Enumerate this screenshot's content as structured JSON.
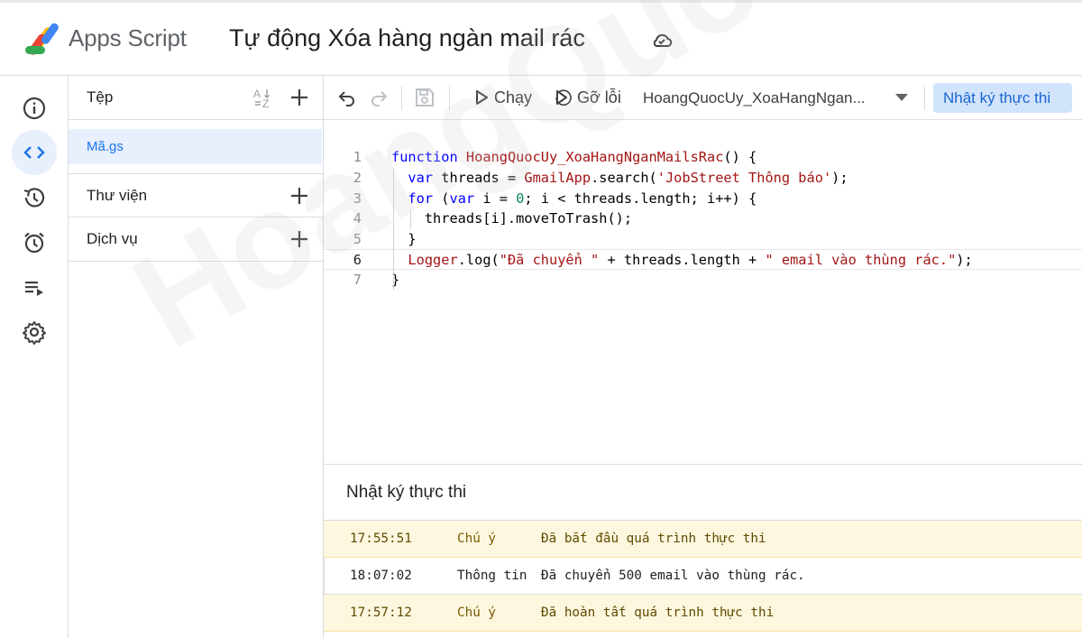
{
  "header": {
    "app_name": "Apps Script",
    "project_title": "Tự động Xóa hàng ngàn mail rác",
    "cloud_status_icon": "cloud-saved-icon"
  },
  "rail": {
    "items": [
      {
        "name": "overview",
        "icon": "info-icon"
      },
      {
        "name": "editor",
        "icon": "code-icon",
        "active": true
      },
      {
        "name": "history",
        "icon": "history-icon"
      },
      {
        "name": "triggers",
        "icon": "alarm-icon"
      },
      {
        "name": "executions",
        "icon": "playlist-play-icon"
      },
      {
        "name": "settings",
        "icon": "gear-icon"
      }
    ]
  },
  "files": {
    "header_label": "Tệp",
    "file_name": "Mã.gs",
    "libraries_label": "Thư viện",
    "services_label": "Dịch vụ"
  },
  "toolbar": {
    "run_label": "Chạy",
    "debug_label": "Gỡ lỗi",
    "function_selected": "HoangQuocUy_XoaHangNganMailsRac",
    "function_display": "HoangQuocUy_XoaHangNgan...",
    "log_button_label": "Nhật ký thực thi"
  },
  "code": {
    "lines": [
      "function HoangQuocUy_XoaHangNganMailsRac() {",
      "  var threads = GmailApp.search('JobStreet Thông báo');",
      "  for (var i = 0; i < threads.length; i++) {",
      "    threads[i].moveToTrash();",
      "  }",
      "  Logger.log(\"Đã chuyển \" + threads.length + \" email vào thùng rác.\");",
      "}"
    ],
    "current_line": 6
  },
  "log": {
    "title": "Nhật ký thực thi",
    "rows": [
      {
        "time": "17:55:51",
        "level": "Chú ý",
        "message": "Đã bắt đầu quá trình thực thi"
      },
      {
        "time": "18:07:02",
        "level": "Thông tin",
        "message": "Đã chuyển 500 email vào thùng rác."
      },
      {
        "time": "17:57:12",
        "level": "Chú ý",
        "message": "Đã hoàn tất quá trình thực thi"
      }
    ]
  },
  "watermark": "HoangQuocUy.Com",
  "colors": {
    "accent": "#1a73e8",
    "active_bg": "#e8f0fe",
    "log_button_bg": "#d2e3fc",
    "warn_row_bg": "#fef7e0"
  }
}
